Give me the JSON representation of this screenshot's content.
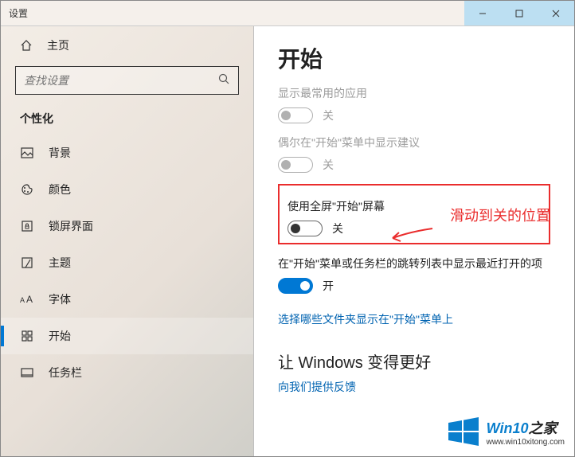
{
  "titlebar": {
    "title": "设置"
  },
  "sidebar": {
    "home": "主页",
    "search_placeholder": "查找设置",
    "section": "个性化",
    "items": [
      {
        "label": "背景"
      },
      {
        "label": "颜色"
      },
      {
        "label": "锁屏界面"
      },
      {
        "label": "主题"
      },
      {
        "label": "字体"
      },
      {
        "label": "开始"
      },
      {
        "label": "任务栏"
      }
    ]
  },
  "content": {
    "title": "开始",
    "opt1": {
      "label": "显示最常用的应用",
      "state": "关"
    },
    "opt2": {
      "label": "偶尔在\"开始\"菜单中显示建议",
      "state": "关"
    },
    "opt3": {
      "label": "使用全屏\"开始\"屏幕",
      "state": "关"
    },
    "opt4": {
      "label": "在\"开始\"菜单或任务栏的跳转列表中显示最近打开的项",
      "state": "开"
    },
    "link1": "选择哪些文件夹显示在\"开始\"菜单上",
    "sectionHeading": "让 Windows 变得更好",
    "link2": "向我们提供反馈"
  },
  "annotation": {
    "text": "滑动到关的位置"
  },
  "watermark": {
    "brand_part1": "Win10",
    "brand_part2": "之家",
    "url": "www.win10xitong.com"
  }
}
